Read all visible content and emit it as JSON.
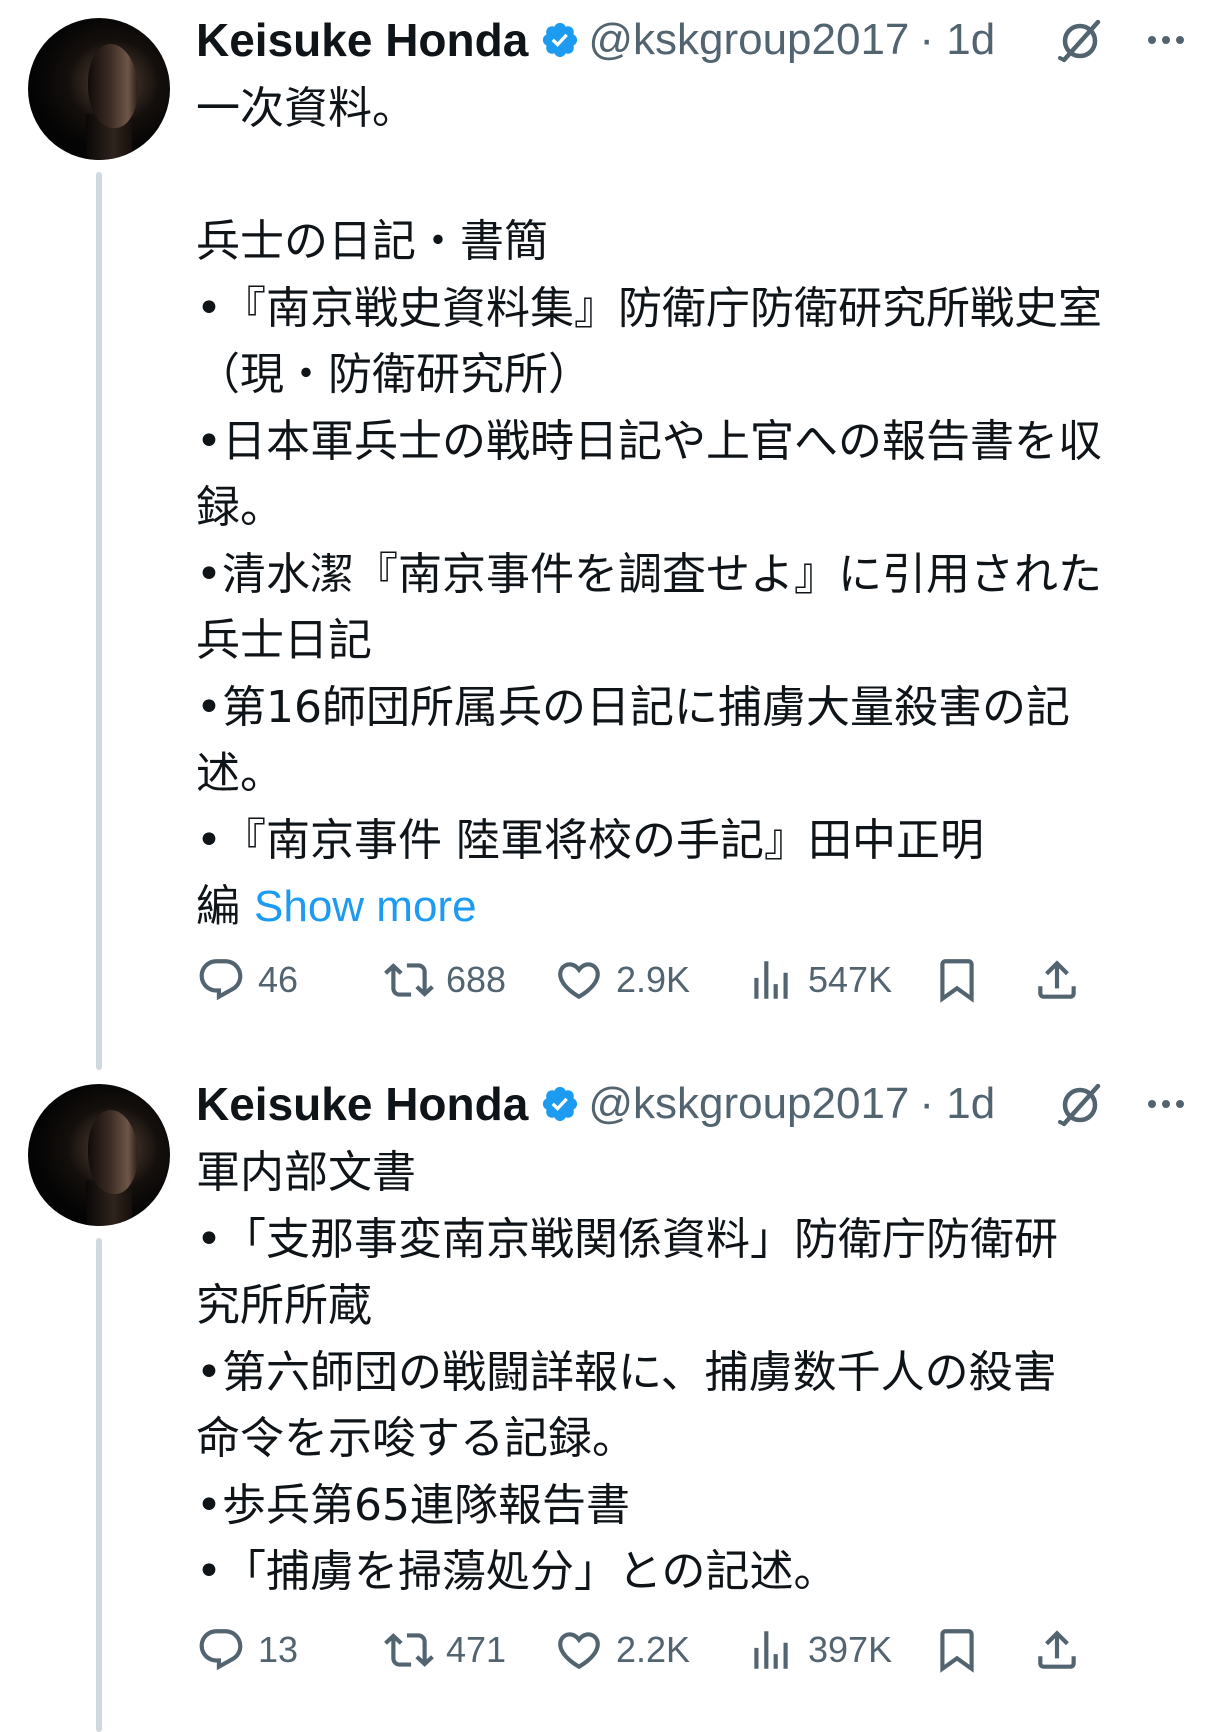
{
  "tweets": [
    {
      "author": {
        "name": "Keisuke Honda",
        "handle": "@kskgroup2017",
        "time": "· 1d"
      },
      "lines": [
        "一次資料。",
        "",
        "兵士の日記・書簡",
        "•『南京戦史資料集』防衛庁防衛研究所戦史室",
        "（現・防衛研究所）",
        "•日本軍兵士の戦時日記や上官への報告書を収",
        "録。",
        "•清水潔『南京事件を調査せよ』に引用された",
        "兵士日記",
        "•第16師団所属兵の日記に捕虜大量殺害の記",
        "述。",
        "•『南京事件 陸軍将校の手記』田中正明",
        "編"
      ],
      "show_more": "Show more",
      "stats": {
        "replies": "46",
        "reposts": "688",
        "likes": "2.9K",
        "views": "547K"
      }
    },
    {
      "author": {
        "name": "Keisuke Honda",
        "handle": "@kskgroup2017",
        "time": "· 1d"
      },
      "lines": [
        "軍内部文書",
        "•「支那事変南京戦関係資料」防衛庁防衛研",
        "究所所蔵",
        "•第六師団の戦闘詳報に、捕虜数千人の殺害",
        "命令を示唆する記録。",
        "•歩兵第65連隊報告書",
        "•「捕虜を掃蕩処分」との記述。"
      ],
      "stats": {
        "replies": "13",
        "reposts": "471",
        "likes": "2.2K",
        "views": "397K"
      }
    }
  ],
  "colors": {
    "accent": "#1d9bf0",
    "muted": "#536471",
    "text": "#0f1419",
    "thread_line": "#cfd9de"
  },
  "icons": [
    "verified-badge-icon",
    "grok-icon",
    "more-icon",
    "reply-icon",
    "repost-icon",
    "like-icon",
    "views-icon",
    "bookmark-icon",
    "share-icon"
  ]
}
